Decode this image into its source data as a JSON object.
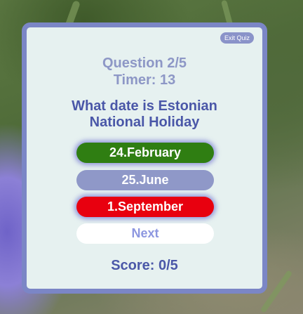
{
  "quiz": {
    "exit_label": "Exit Quiz",
    "question_counter": "Question 2/5",
    "timer": "Timer: 13",
    "question": "What date is Estonian National Holiday",
    "answers": [
      {
        "label": "24.February",
        "state": "correct",
        "color": "#2f7e12"
      },
      {
        "label": "25.June",
        "state": "neutral",
        "color": "#8f98c8"
      },
      {
        "label": "1.September",
        "state": "wrong",
        "color": "#e8000f"
      }
    ],
    "next_label": "Next",
    "score": "Score: 0/5"
  },
  "colors": {
    "card_border": "#7b86c6",
    "card_background": "#e6f1f0",
    "primary_text": "#4a57a8",
    "muted_text": "#8d97c6"
  }
}
